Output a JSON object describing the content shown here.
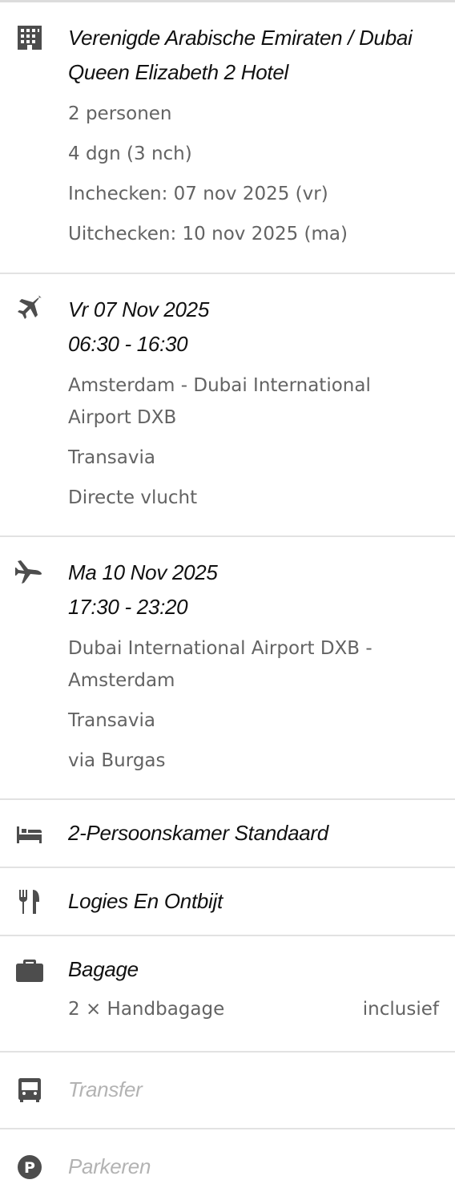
{
  "hotel": {
    "icon": "building-icon",
    "location": "Verenigde Arabische Emiraten / Dubai",
    "name": "Queen Elizabeth 2 Hotel",
    "persons": "2 personen",
    "duration": "4 dgn (3 nch)",
    "checkin": "Inchecken: 07 nov 2025 (vr)",
    "checkout": "Uitchecken: 10 nov 2025 (ma)"
  },
  "outbound": {
    "icon": "airplane-departure-icon",
    "date": "Vr 07 Nov 2025",
    "time": "06:30 - 16:30",
    "route": "Amsterdam - Dubai International Airport DXB",
    "airline": "Transavia",
    "type": "Directe vlucht"
  },
  "return": {
    "icon": "airplane-arrival-icon",
    "date": "Ma 10 Nov 2025",
    "time": "17:30 - 23:20",
    "route": "Dubai International Airport DXB - Amsterdam",
    "airline": "Transavia",
    "type": "via Burgas"
  },
  "room": {
    "icon": "bed-icon",
    "label": "2-Persoonskamer Standaard"
  },
  "board": {
    "icon": "fork-knife-icon",
    "label": "Logies En Ontbijt"
  },
  "baggage": {
    "icon": "suitcase-icon",
    "label": "Bagage",
    "item": "2 × Handbagage",
    "status": "inclusief"
  },
  "transfer": {
    "icon": "bus-icon",
    "label": "Transfer"
  },
  "parking": {
    "icon": "parking-icon",
    "label": "Parkeren"
  },
  "colors": {
    "title": "#111111",
    "detail": "#636363",
    "muted": "#b3b3b3",
    "icon": "#4d4d4d",
    "divider": "#e2e2e2"
  }
}
